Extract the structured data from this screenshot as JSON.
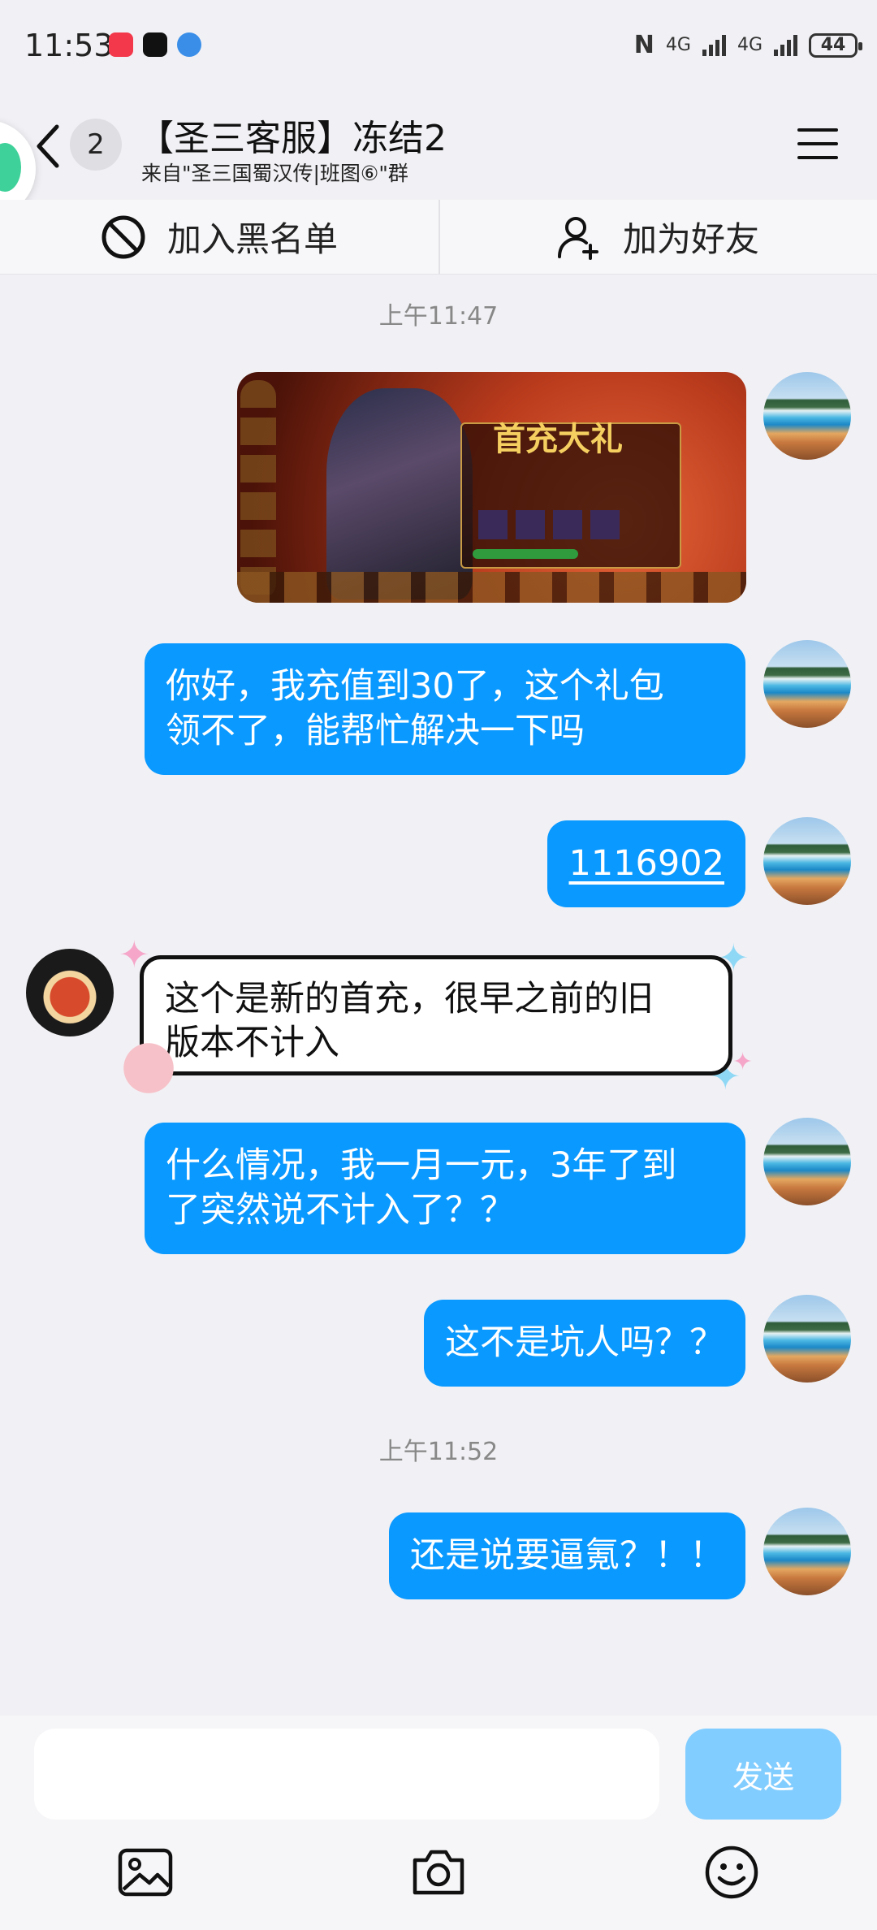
{
  "status_bar": {
    "time": "11:53",
    "battery": "44",
    "net_1": "4G",
    "net_2": "4G"
  },
  "header": {
    "unread_count": "2",
    "title": "【圣三客服】冻结2",
    "subtitle": "来自\"圣三国蜀汉传|班图⑥\"群"
  },
  "actions": {
    "block_label": "加入黑名单",
    "add_friend_label": "加为好友"
  },
  "game_image": {
    "title": "首充大礼"
  },
  "messages": [
    {
      "time": "上午11:47"
    },
    {
      "text_line1": "你好，我充值到30了，这个礼包",
      "text_line2": "领不了，能帮忙解决一下吗"
    },
    {
      "text": "1116902"
    },
    {
      "text_line1": "这个是新的首充，很早之前的旧",
      "text_line2": "版本不计入"
    },
    {
      "text_line1": "什么情况，我一月一元，3年了到",
      "text_line2": "了突然说不计入了？？"
    },
    {
      "text": "这不是坑人吗？？"
    },
    {
      "time": "上午11:52"
    },
    {
      "text": "还是说要逼氪？！！"
    }
  ],
  "composer": {
    "input_value": "",
    "send_label": "发送"
  },
  "icons": {
    "image": "image-icon",
    "camera": "camera-icon",
    "emoji": "emoji-icon"
  },
  "colors": {
    "bubble_blue": "#0a99ff",
    "send_disabled": "#82cdff",
    "background": "#f1f1f5"
  }
}
